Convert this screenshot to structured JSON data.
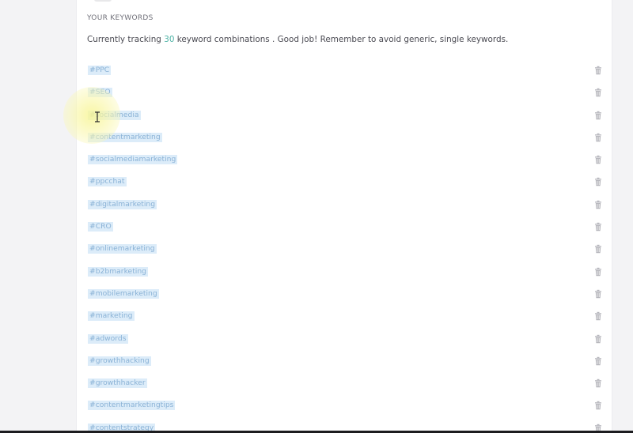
{
  "keywords_section": {
    "title": "YOUR KEYWORDS",
    "summary_prefix": "Currently tracking",
    "count": "30",
    "summary_suffix": "keyword combinations . Good job! Remember to avoid generic, single keywords."
  },
  "keywords": [
    {
      "label": "#PPC",
      "delete_icon": "trash-icon"
    },
    {
      "label": "#SEO",
      "delete_icon": "trash-icon"
    },
    {
      "label": "#socialmedia",
      "delete_icon": "trash-icon"
    },
    {
      "label": "#contentmarketing",
      "delete_icon": "trash-icon"
    },
    {
      "label": "#socialmediamarketing",
      "delete_icon": "trash-icon"
    },
    {
      "label": "#ppcchat",
      "delete_icon": "trash-icon"
    },
    {
      "label": "#digitalmarketing",
      "delete_icon": "trash-icon"
    },
    {
      "label": "#CRO",
      "delete_icon": "trash-icon"
    },
    {
      "label": "#onlinemarketing",
      "delete_icon": "trash-icon"
    },
    {
      "label": "#b2bmarketing",
      "delete_icon": "trash-icon"
    },
    {
      "label": "#mobilemarketing",
      "delete_icon": "trash-icon"
    },
    {
      "label": "#marketing",
      "delete_icon": "trash-icon"
    },
    {
      "label": "#adwords",
      "delete_icon": "trash-icon"
    },
    {
      "label": "#growthhacking",
      "delete_icon": "trash-icon"
    },
    {
      "label": "#growthhacker",
      "delete_icon": "trash-icon"
    },
    {
      "label": "#contentmarketingtips",
      "delete_icon": "trash-icon"
    },
    {
      "label": "#contentstrategy",
      "delete_icon": "trash-icon"
    }
  ],
  "colors": {
    "accent_count": "#4fb3a6",
    "keyword_text": "#8ab2d6",
    "keyword_highlight": "#dcecf9",
    "trash_icon": "#b7b7bd"
  }
}
